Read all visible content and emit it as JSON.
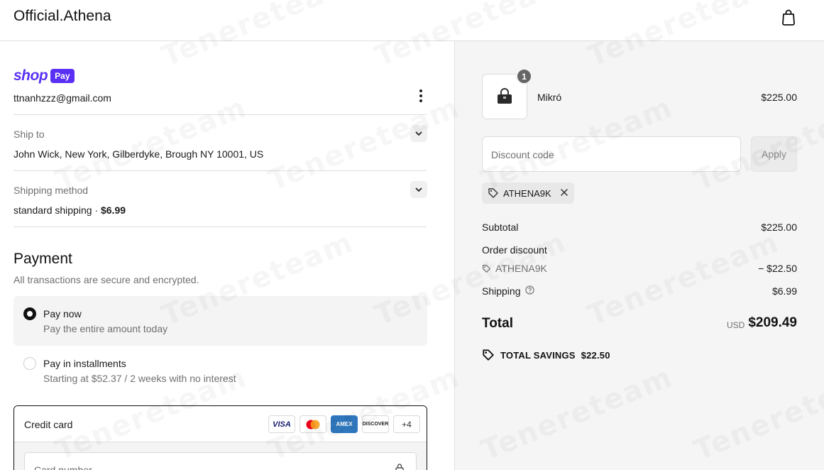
{
  "header": {
    "brand": "Official.Athena",
    "cart_icon": "shopping-bag-icon"
  },
  "left": {
    "shop_pay": {
      "shop": "shop",
      "pay": "Pay"
    },
    "account_email": "ttnanhzzz@gmail.com",
    "ship_to": {
      "label": "Ship to",
      "value": "John Wick, New York, Gilberdyke, Brough NY 10001, US"
    },
    "shipping_method": {
      "label": "Shipping method",
      "value": "standard shipping",
      "separator": "·",
      "price": "$6.99"
    },
    "payment": {
      "title": "Payment",
      "subtitle": "All transactions are secure and encrypted.",
      "options": [
        {
          "title": "Pay now",
          "subtitle": "Pay the entire amount today",
          "selected": true
        },
        {
          "title": "Pay in installments",
          "subtitle": "Starting at $52.37 / 2 weeks with no interest",
          "selected": false
        }
      ],
      "credit_card": {
        "label": "Credit card",
        "brands": [
          "VISA",
          "MC",
          "AMEX",
          "DISCOVER"
        ],
        "more": "+4",
        "card_number_placeholder": "Card number"
      }
    }
  },
  "right": {
    "product": {
      "name": "Mikró",
      "price": "$225.00",
      "quantity": "1"
    },
    "discount": {
      "placeholder": "Discount code",
      "apply": "Apply",
      "applied_code": "ATHENA9K"
    },
    "summary": {
      "subtotal_label": "Subtotal",
      "subtotal": "$225.00",
      "order_discount_label": "Order discount",
      "discount_code": "ATHENA9K",
      "discount_amount": "− $22.50",
      "shipping_label": "Shipping",
      "shipping": "$6.99",
      "total_label": "Total",
      "currency": "USD",
      "total": "$209.49",
      "savings_label": "TOTAL SAVINGS",
      "savings": "$22.50"
    }
  },
  "watermark": "Tenereteam",
  "colors": {
    "shop_pay": "#5a31f4",
    "summary_bg": "#f5f5f5"
  }
}
